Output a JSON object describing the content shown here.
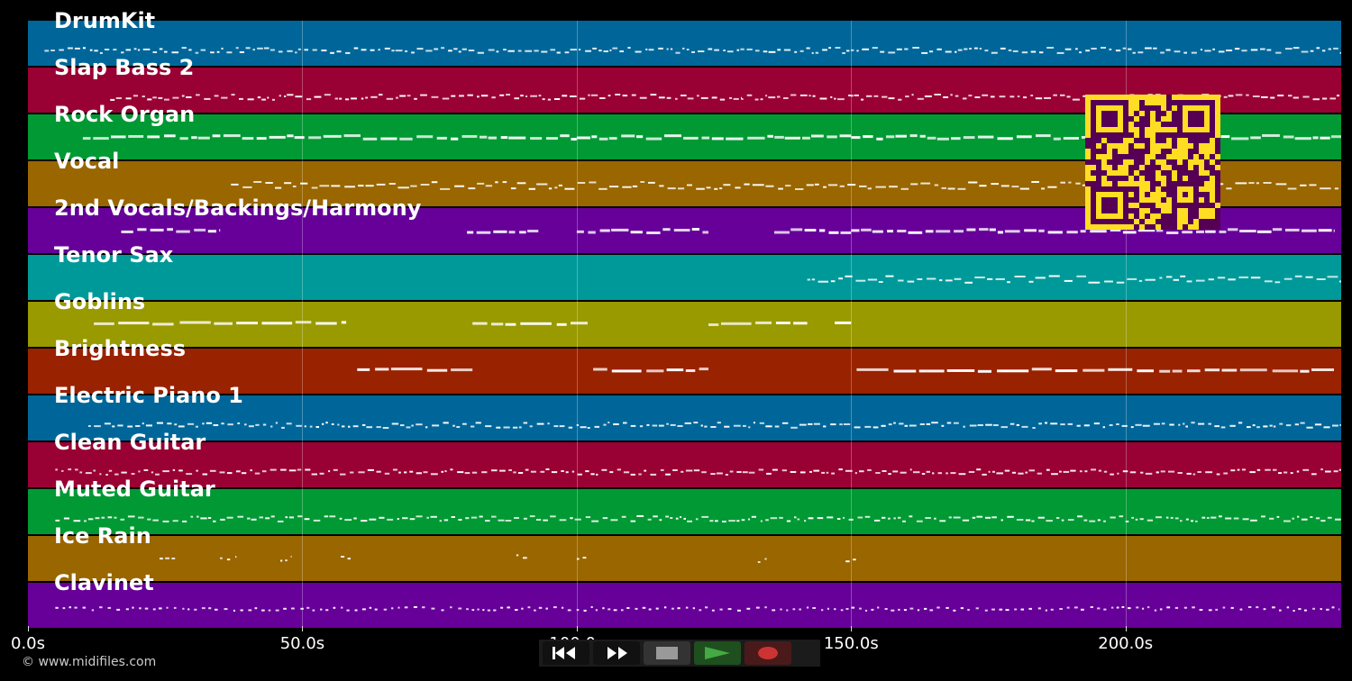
{
  "tracks": [
    {
      "name": "DrumKit",
      "color": "#006699",
      "pattern": "dense",
      "segments": [
        [
          3,
          241
        ]
      ]
    },
    {
      "name": "Slap Bass 2",
      "color": "#990033",
      "pattern": "dense",
      "segments": [
        [
          15,
          130
        ],
        [
          130,
          150
        ],
        [
          150,
          240
        ]
      ]
    },
    {
      "name": "Rock Organ",
      "color": "#009933",
      "pattern": "blocks",
      "segments": [
        [
          10,
          100
        ],
        [
          100,
          150
        ],
        [
          150,
          241
        ]
      ]
    },
    {
      "name": "Vocal",
      "color": "#996600",
      "pattern": "wavy",
      "segments": [
        [
          37,
          241
        ]
      ]
    },
    {
      "name": "2nd Vocals/Backings/Harmony",
      "color": "#660099",
      "pattern": "blocks",
      "segments": [
        [
          17,
          35
        ],
        [
          80,
          93
        ],
        [
          100,
          124
        ],
        [
          136,
          150
        ],
        [
          150,
          238
        ]
      ]
    },
    {
      "name": "Tenor Sax",
      "color": "#009999",
      "pattern": "wavy",
      "segments": [
        [
          142,
          241
        ]
      ]
    },
    {
      "name": "Goblins",
      "color": "#999900",
      "pattern": "long",
      "segments": [
        [
          12,
          58
        ],
        [
          81,
          102
        ],
        [
          124,
          142
        ],
        [
          147,
          150
        ]
      ]
    },
    {
      "name": "Brightness",
      "color": "#992200",
      "pattern": "long",
      "segments": [
        [
          60,
          81
        ],
        [
          103,
          124
        ],
        [
          151,
          238
        ]
      ]
    },
    {
      "name": "Electric Piano 1",
      "color": "#006699",
      "pattern": "dense",
      "segments": [
        [
          11,
          241
        ]
      ]
    },
    {
      "name": "Clean Guitar",
      "color": "#990033",
      "pattern": "dense",
      "segments": [
        [
          5,
          241
        ]
      ]
    },
    {
      "name": "Muted Guitar",
      "color": "#009933",
      "pattern": "dense",
      "segments": [
        [
          5,
          241
        ]
      ]
    },
    {
      "name": "Ice Rain",
      "color": "#996600",
      "pattern": "sparse",
      "segments": [
        [
          24,
          27
        ],
        [
          35,
          38
        ],
        [
          46,
          48
        ],
        [
          57,
          59
        ],
        [
          89,
          91
        ],
        [
          100,
          102
        ],
        [
          133,
          135
        ],
        [
          149,
          151
        ]
      ]
    },
    {
      "name": "Clavinet",
      "color": "#660099",
      "pattern": "dotted",
      "segments": [
        [
          5,
          239
        ]
      ]
    }
  ],
  "axis": {
    "max_seconds": 239.3,
    "ticks": [
      {
        "label": "0.0s",
        "seconds": 0
      },
      {
        "label": "50.0s",
        "seconds": 50
      },
      {
        "label": "100.0s",
        "seconds": 100
      },
      {
        "label": "150.0s",
        "seconds": 150
      },
      {
        "label": "200.0s",
        "seconds": 200
      }
    ]
  },
  "copyright": "© www.midifiles.com",
  "transport": {
    "rewind_icon": "rewind-icon",
    "forward_icon": "fast-forward-icon",
    "stop_icon": "stop-icon",
    "play_icon": "play-icon",
    "record_icon": "record-icon",
    "play_color": "#44aa44",
    "record_color": "#cc3333"
  },
  "qr": {
    "icon": "qr-code-icon",
    "fg": "#550055",
    "bg": "#ffdd22"
  }
}
